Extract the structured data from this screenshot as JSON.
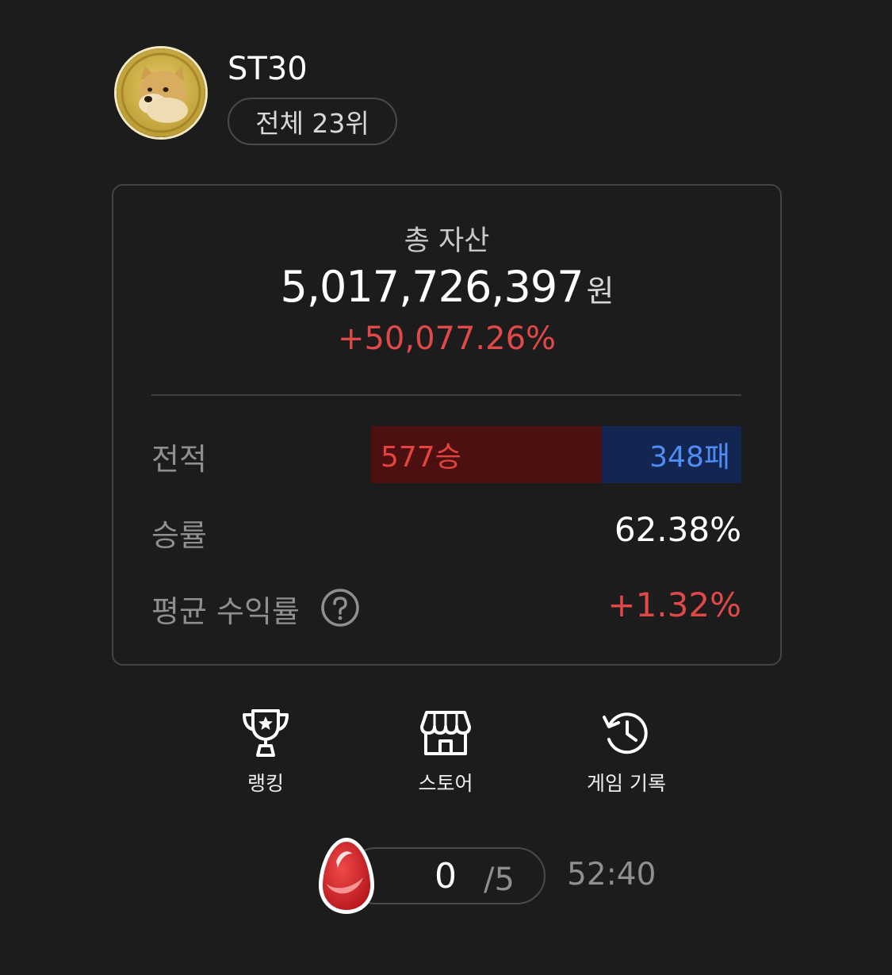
{
  "profile": {
    "username": "ST30",
    "rank": "전체 23위"
  },
  "assets": {
    "label": "총 자산",
    "value": "5,017,726,397",
    "unit": "원",
    "change_pct": "+50,077.26%"
  },
  "stats": {
    "record_label": "전적",
    "wins": "577승",
    "losses": "348패",
    "win_fraction": 0.6238,
    "winrate_label": "승률",
    "winrate": "62.38%",
    "avg_return_label": "평균 수익률",
    "avg_return": "+1.32%"
  },
  "actions": [
    {
      "label": "랭킹",
      "icon": "trophy-icon"
    },
    {
      "label": "스토어",
      "icon": "store-icon"
    },
    {
      "label": "게임 기록",
      "icon": "history-icon"
    }
  ],
  "energy": {
    "current": "0",
    "max": "/5",
    "timer": "52:40"
  },
  "colors": {
    "background": "#1c1c1d",
    "positive": "#e14848",
    "win_bg": "#4c1010",
    "lose_bg": "#132551",
    "lose_text": "#4f8cf4"
  }
}
